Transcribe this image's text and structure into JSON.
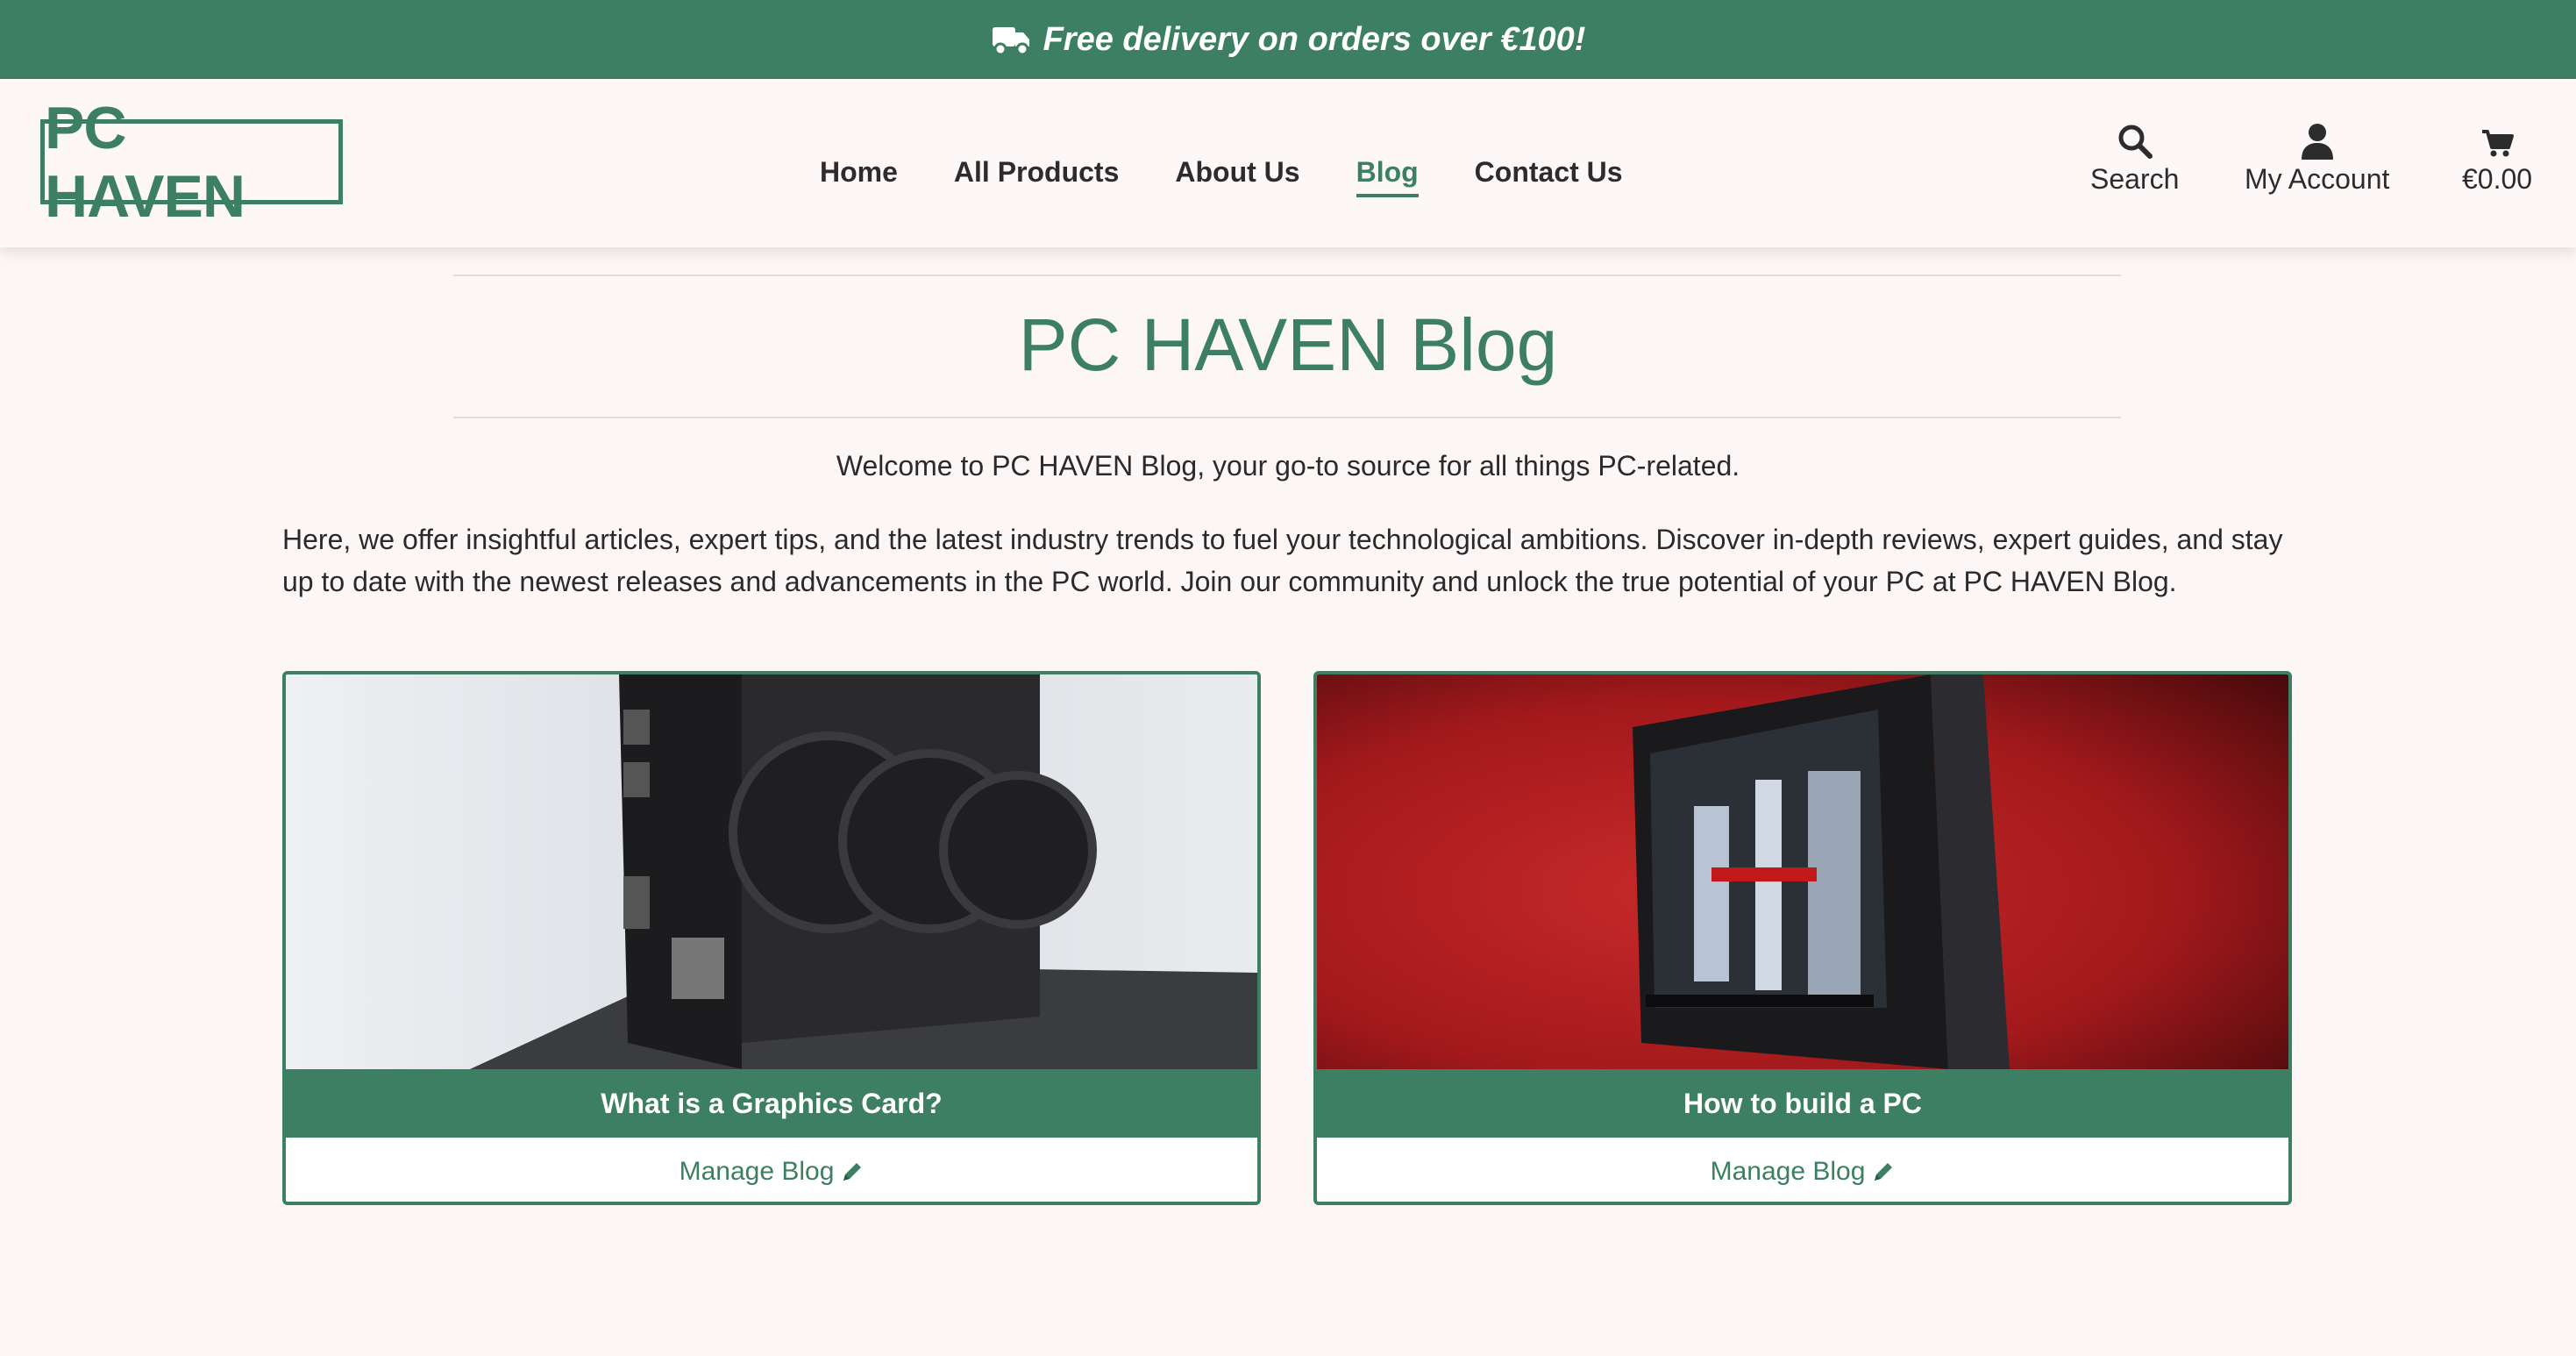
{
  "banner": {
    "text": "Free delivery on orders over €100!",
    "icon": "truck-icon"
  },
  "header": {
    "logo": "PC HAVEN",
    "nav": [
      {
        "label": "Home",
        "active": false
      },
      {
        "label": "All Products",
        "active": false
      },
      {
        "label": "About Us",
        "active": false
      },
      {
        "label": "Blog",
        "active": true
      },
      {
        "label": "Contact Us",
        "active": false
      }
    ],
    "search_label": "Search",
    "account_label": "My Account",
    "cart_total": "€0.00"
  },
  "main": {
    "title": "PC HAVEN Blog",
    "welcome": "Welcome to PC HAVEN Blog, your go-to source for all things PC-related.",
    "intro": "Here, we offer insightful articles, expert tips, and the latest industry trends to fuel your technological ambitions. Discover in-depth reviews, expert guides, and stay up to date with the newest releases and advancements in the PC world. Join our community and unlock the true potential of your PC at PC HAVEN Blog.",
    "posts": [
      {
        "title": "What is a Graphics Card?",
        "manage_label": "Manage Blog",
        "image": "graphics-card-photo"
      },
      {
        "title": "How to build a PC",
        "manage_label": "Manage Blog",
        "image": "pc-case-photo"
      }
    ]
  },
  "colors": {
    "brand": "#3d7f62",
    "background": "#fcf7f6"
  }
}
